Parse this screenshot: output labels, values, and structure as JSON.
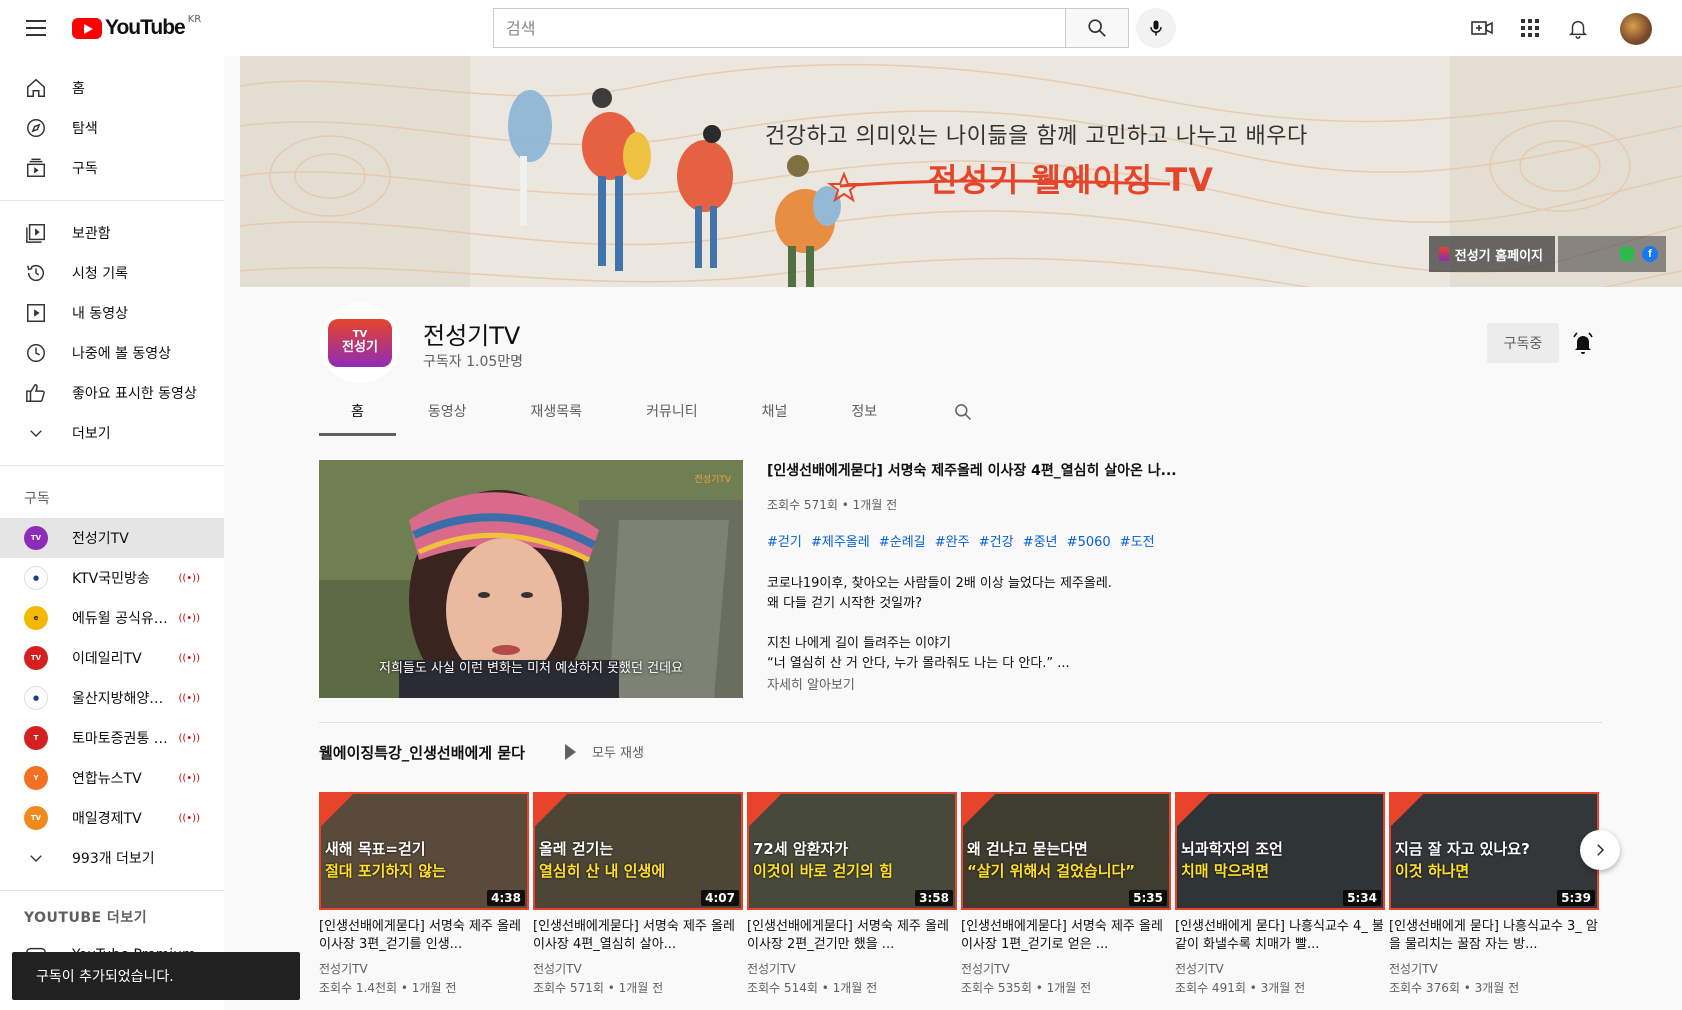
{
  "header": {
    "logo_text": "YouTube",
    "logo_country": "KR",
    "search_placeholder": "검색"
  },
  "sidebar": {
    "main": [
      {
        "label": "홈",
        "icon": "home-icon"
      },
      {
        "label": "탐색",
        "icon": "compass-icon"
      },
      {
        "label": "구독",
        "icon": "subscriptions-icon"
      }
    ],
    "library": [
      {
        "label": "보관함",
        "icon": "library-icon"
      },
      {
        "label": "시청 기록",
        "icon": "history-icon"
      },
      {
        "label": "내 동영상",
        "icon": "my-videos-icon"
      },
      {
        "label": "나중에 볼 동영상",
        "icon": "watch-later-icon"
      },
      {
        "label": "좋아요 표시한 동영상",
        "icon": "thumbs-up-icon"
      },
      {
        "label": "더보기",
        "icon": "chevron-down-icon"
      }
    ],
    "subscriptions_title": "구독",
    "subscriptions": [
      {
        "label": "전성기TV",
        "color": "#8e2bb8",
        "live": false,
        "active": true
      },
      {
        "label": "KTV국민방송",
        "color": "#ffffff",
        "live": true,
        "active": false
      },
      {
        "label": "에듀윌 공식유튜브",
        "color": "#f5b800",
        "live": true,
        "active": false
      },
      {
        "label": "이데일리TV",
        "color": "#d6201f",
        "live": true,
        "active": false
      },
      {
        "label": "울산지방해양수산청",
        "color": "#ffffff",
        "live": true,
        "active": false
      },
      {
        "label": "토마토증권통 Toma...",
        "color": "#d6201f",
        "live": true,
        "active": false
      },
      {
        "label": "연합뉴스TV",
        "color": "#f36f21",
        "live": true,
        "active": false
      },
      {
        "label": "매일경제TV",
        "color": "#f08a1e",
        "live": true,
        "active": false
      }
    ],
    "more_subs_label": "993개 더보기",
    "more_title": "YOUTUBE 더보기",
    "premium_label": "YouTube Premium",
    "live_glyph": "((•))"
  },
  "toast": {
    "text": "구독이 추가되었습니다."
  },
  "banner": {
    "slogan": "건강하고 의미있는 나이듦을 함께 고민하고 나누고 배우다",
    "title": "전성기 웰에이징 TV",
    "link_label": "전성기 홈페이지"
  },
  "channel": {
    "name": "전성기TV",
    "subscribers": "구독자 1.05만명",
    "avatar_text": "전성기",
    "avatar_tv": "TV",
    "subscribe_label": "구독중",
    "tabs": [
      "홈",
      "동영상",
      "재생목록",
      "커뮤니티",
      "채널",
      "정보"
    ]
  },
  "featured": {
    "title": "[인생선배에게묻다] 서명숙 제주올레 이사장 4편_열심히 살아온 나...",
    "meta": "조회수 571회 • 1개월 전",
    "tags": [
      "#걷기",
      "#제주올레",
      "#순례길",
      "#완주",
      "#건강",
      "#중년",
      "#5060",
      "#도전"
    ],
    "desc1_line1": "코로나19이후, 찾아오는 사람들이 2배 이상 늘었다는 제주올레.",
    "desc1_line2": "왜 다들 걷기 시작한 것일까?",
    "desc2_line1": "지친 나에게 길이 들려주는 이야기",
    "desc2_line2": "“너 열심히 산 거 안다, 누가 몰라줘도 나는 다 안다.” ...",
    "more_label": "자세히 알아보기",
    "thumb_caption": "저희들도 사실 이런 변화는 미처 예상하지 못했던 건데요",
    "thumb_tag": "전성기TV"
  },
  "shelf": {
    "title": "웰에이징특강_인생선배에게 묻다",
    "play_all": "모두 재생",
    "videos": [
      {
        "line1": "새해 목표=걷기",
        "line2": "절대 포기하지 않는",
        "duration": "4:38",
        "title": "[인생선배에게묻다] 서명숙 제주 올레 이사장 3편_걷기를 인생...",
        "channel": "전성기TV",
        "meta": "조회수 1.4천회 • 1개월 전",
        "bg": "#5a4a3a"
      },
      {
        "line1": "올레 걷기는",
        "line2": "열심히 산 내 인생에",
        "duration": "4:07",
        "title": "[인생선배에게묻다] 서명숙 제주 올레 이사장 4편_열심히 살아...",
        "channel": "전성기TV",
        "meta": "조회수 571회 • 1개월 전",
        "bg": "#4d4536"
      },
      {
        "line1": "72세 암환자가",
        "line2": "이것이 바로 걷기의 힘",
        "duration": "3:58",
        "title": "[인생선배에게묻다] 서명숙 제주 올레 이사장 2편_걷기만 했을 ...",
        "channel": "전성기TV",
        "meta": "조회수 514회 • 1개월 전",
        "bg": "#474a3a"
      },
      {
        "line1": "왜 걷냐고 묻는다면",
        "line2": "“살기 위해서 걸었습니다”",
        "duration": "5:35",
        "title": "[인생선배에게묻다] 서명숙 제주 올레 이사장 1편_걷기로 얻은 ...",
        "channel": "전성기TV",
        "meta": "조회수 535회 • 1개월 전",
        "bg": "#3f3c30"
      },
      {
        "line1": "뇌과학자의 조언",
        "line2": "치매 막으려면",
        "duration": "5:34",
        "title": "[인생선배에게 묻다] 나흥식교수 4_ 불같이 화낼수록 치매가 빨...",
        "channel": "전성기TV",
        "meta": "조회수 491회 • 3개월 전",
        "bg": "#2f3436"
      },
      {
        "line1": "지금 잘 자고 있나요?",
        "line2": "이것 하나면",
        "duration": "5:39",
        "title": "[인생선배에게 묻다] 나흥식교수 3_ 암을 물리치는 꿀잠 자는 방...",
        "channel": "전성기TV",
        "meta": "조회수 376회 • 3개월 전",
        "bg": "#33373a"
      }
    ]
  }
}
